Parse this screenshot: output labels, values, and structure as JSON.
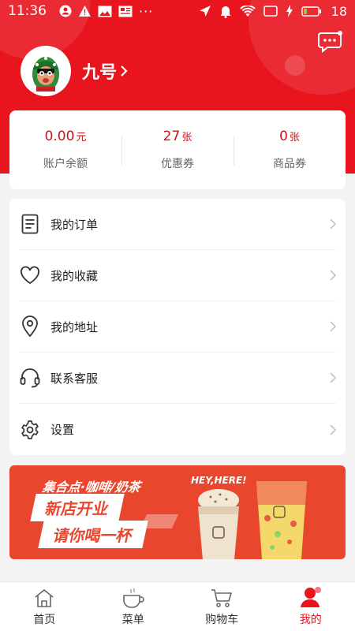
{
  "status_bar": {
    "time": "11:36",
    "battery": "18",
    "more": "···"
  },
  "user": {
    "name": "九号"
  },
  "stats": [
    {
      "value": "0.00",
      "unit": "元",
      "label": "账户余额"
    },
    {
      "value": "27",
      "unit": "张",
      "label": "优惠券"
    },
    {
      "value": "0",
      "unit": "张",
      "label": "商品券"
    }
  ],
  "menu": [
    {
      "label": "我的订单",
      "icon": "order-list-icon"
    },
    {
      "label": "我的收藏",
      "icon": "heart-icon"
    },
    {
      "label": "我的地址",
      "icon": "location-pin-icon"
    },
    {
      "label": "联系客服",
      "icon": "headset-icon"
    },
    {
      "label": "设置",
      "icon": "gear-icon"
    }
  ],
  "banner": {
    "line1": "集合点·咖啡/奶茶",
    "line2": "新店开业",
    "line3": "请你喝一杯",
    "hey": "HEY,HERE!"
  },
  "tabs": [
    {
      "label": "首页",
      "icon": "home-icon"
    },
    {
      "label": "菜单",
      "icon": "coffee-cup-icon"
    },
    {
      "label": "购物车",
      "icon": "cart-icon"
    },
    {
      "label": "我的",
      "icon": "profile-icon",
      "active": true
    }
  ],
  "colors": {
    "brand_red": "#e8141e",
    "price_red": "#c8161d",
    "banner_orange": "#e8472d"
  }
}
